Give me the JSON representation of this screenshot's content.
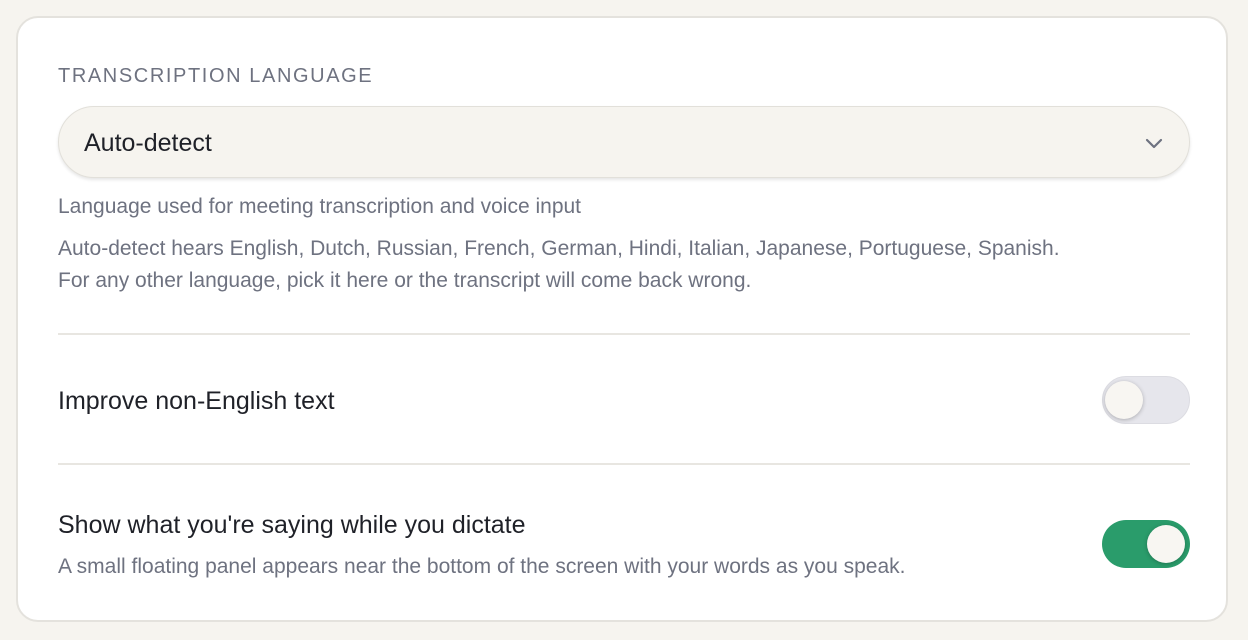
{
  "transcription": {
    "section_label": "TRANSCRIPTION LANGUAGE",
    "selected_language": "Auto-detect",
    "help_primary": "Language used for meeting transcription and voice input",
    "help_secondary_line1": "Auto-detect hears English, Dutch, Russian, French, German, Hindi, Italian, Japanese, Portuguese, Spanish.",
    "help_secondary_line2": "For any other language, pick it here or the transcript will come back wrong."
  },
  "settings": {
    "improve_non_english": {
      "label": "Improve non-English text",
      "enabled": false
    },
    "live_dictation_preview": {
      "label": "Show what you're saying while you dictate",
      "description": "A small floating panel appears near the bottom of the screen with your words as you speak.",
      "enabled": true
    }
  },
  "colors": {
    "toggle_on": "#2a9c6b",
    "toggle_off": "#e6e6ec",
    "muted_text": "#6e7280",
    "primary_text": "#1f2128"
  },
  "icons": {
    "select_chevron": "chevron-down-icon"
  }
}
